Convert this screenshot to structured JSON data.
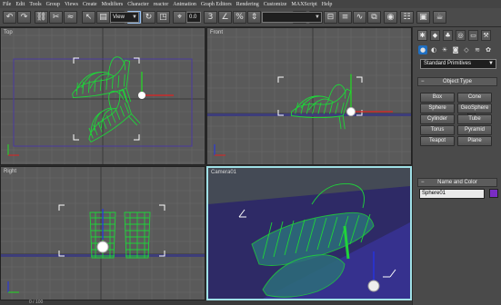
{
  "menu": [
    "File",
    "Edit",
    "Tools",
    "Group",
    "Views",
    "Create",
    "Modifiers",
    "Character",
    "reactor",
    "Animation",
    "Graph Editors",
    "Rendering",
    "Customize",
    "MAXScript",
    "Help"
  ],
  "toolbar": {
    "buttons": [
      {
        "name": "undo-icon",
        "glyph": "↶"
      },
      {
        "name": "redo-icon",
        "glyph": "↷"
      },
      {
        "name": "select-link-icon",
        "glyph": "⛓"
      },
      {
        "name": "unlink-icon",
        "glyph": "✂"
      },
      {
        "name": "bind-space-warp-icon",
        "glyph": "≈"
      },
      {
        "name": "select-object-icon",
        "glyph": "↖"
      },
      {
        "name": "select-by-name-icon",
        "glyph": "▤"
      },
      {
        "name": "selection-region-icon",
        "glyph": "▢"
      },
      {
        "name": "select-and-move-icon",
        "glyph": "✥"
      },
      {
        "name": "select-and-rotate-icon",
        "glyph": "↻"
      },
      {
        "name": "select-and-scale-icon",
        "glyph": "◳"
      },
      {
        "name": "use-pivot-icon",
        "glyph": "⌖"
      },
      {
        "name": "snaps-toggle-icon",
        "glyph": "3"
      },
      {
        "name": "angle-snap-icon",
        "glyph": "∠"
      },
      {
        "name": "percent-snap-icon",
        "glyph": "%"
      },
      {
        "name": "spinner-snap-icon",
        "glyph": "⇕"
      },
      {
        "name": "named-selection-icon",
        "glyph": "⊞"
      },
      {
        "name": "mirror-icon",
        "glyph": "⇋"
      },
      {
        "name": "align-icon",
        "glyph": "⊟"
      },
      {
        "name": "layer-manager-icon",
        "glyph": "≡"
      },
      {
        "name": "curve-editor-icon",
        "glyph": "∿"
      },
      {
        "name": "schematic-view-icon",
        "glyph": "⧉"
      },
      {
        "name": "material-editor-icon",
        "glyph": "◉"
      },
      {
        "name": "render-setup-icon",
        "glyph": "☷"
      },
      {
        "name": "render-frame-icon",
        "glyph": "▣"
      },
      {
        "name": "quick-render-icon",
        "glyph": "☕"
      }
    ],
    "coordinate_system": "View",
    "spinner_value": "0.0",
    "named_selection": ""
  },
  "viewports": {
    "top_label": "Top",
    "front_label": "Front",
    "left_label": "Right",
    "camera_label": "Camera01"
  },
  "command_panel": {
    "tabs": [
      "create-tab",
      "modify-tab",
      "hierarchy-tab",
      "motion-tab",
      "display-tab",
      "utilities-tab"
    ],
    "tab_glyphs": [
      "✱",
      "◆",
      "♣",
      "◎",
      "▭",
      "⚒"
    ],
    "categories": [
      "geometry-category-icon",
      "shapes-category-icon",
      "lights-category-icon",
      "cameras-category-icon",
      "helpers-category-icon",
      "space-warps-category-icon",
      "systems-category-icon"
    ],
    "category_glyphs": [
      "●",
      "◐",
      "☀",
      "◙",
      "◇",
      "≋",
      "✿"
    ],
    "primitives_type": "Standard Primitives",
    "object_type_title": "Object Type",
    "autogrid_label": "AutoGrid",
    "object_buttons": [
      "Box",
      "Cone",
      "Sphere",
      "GeoSphere",
      "Cylinder",
      "Tube",
      "Torus",
      "Pyramid",
      "Teapot",
      "Plane"
    ],
    "name_color_title": "Name and Color",
    "object_name": "Sphere01",
    "object_color": "#7a2cc4"
  },
  "status": {
    "time_range": "0 / 100"
  },
  "colors": {
    "wireframe": "#1fd43a",
    "gizmo_x": "#e02020",
    "gizmo_y": "#22dd22",
    "gizmo_z": "#2233ee",
    "active_viewport_border": "#9fe0e6",
    "grid_line": "#6a6a6a",
    "grid_major": "#3a3a3a"
  }
}
